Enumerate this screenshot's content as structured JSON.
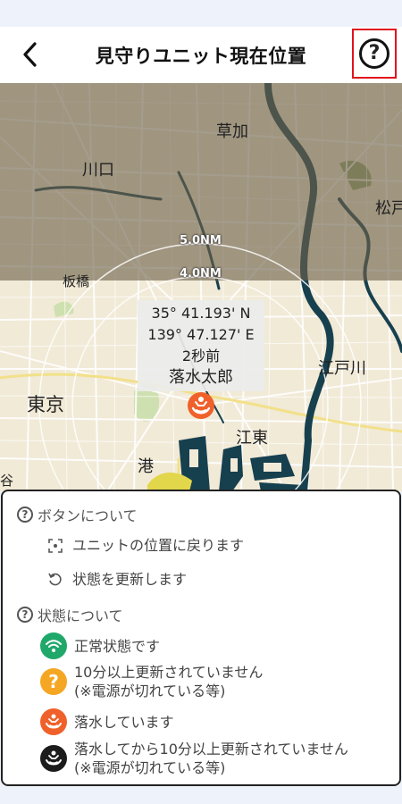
{
  "header": {
    "title": "見守りユニット現在位置",
    "back_icon": "chevron-left-icon",
    "help_icon": "question-circle-icon",
    "help_highlight_color": "#e0141e"
  },
  "map": {
    "places": {
      "soka": "草加",
      "kawaguchi": "川口",
      "matsudo": "松戸",
      "itabashi": "板橋",
      "edogawa": "江戸川",
      "tokyo": "東京",
      "koto": "江東",
      "minato": "港",
      "edge_ya": "谷"
    },
    "range_rings": {
      "outer": "5.0NM",
      "inner": "4.0NM"
    },
    "unit_info": {
      "lat": "35° 41.193' N",
      "lon": "139° 47.127' E",
      "elapsed": "2秒前",
      "name": "落水太郎"
    },
    "colors": {
      "land": "#f1ead7",
      "shaded": "#9c9179",
      "water": "#17404f",
      "unit_pin": "#f0602a"
    }
  },
  "legend": {
    "buttons_section": "ボタンについて",
    "locate_text": "ユニットの位置に戻ります",
    "refresh_text": "状態を更新します",
    "status_section": "状態について",
    "items": [
      {
        "icon": "wifi-icon",
        "color": "#1fa86a",
        "line1": "正常状態です",
        "line2": ""
      },
      {
        "icon": "question-icon",
        "color": "#f5a623",
        "line1": "10分以上更新されていません",
        "line2": "(※電源が切れている等)"
      },
      {
        "icon": "person-overboard-icon",
        "color": "#f0602a",
        "line1": "落水しています",
        "line2": ""
      },
      {
        "icon": "person-overboard-dark-icon",
        "color": "#1c1c1c",
        "line1": "落水してから10分以上更新されていません",
        "line2": "(※電源が切れている等)"
      }
    ]
  }
}
